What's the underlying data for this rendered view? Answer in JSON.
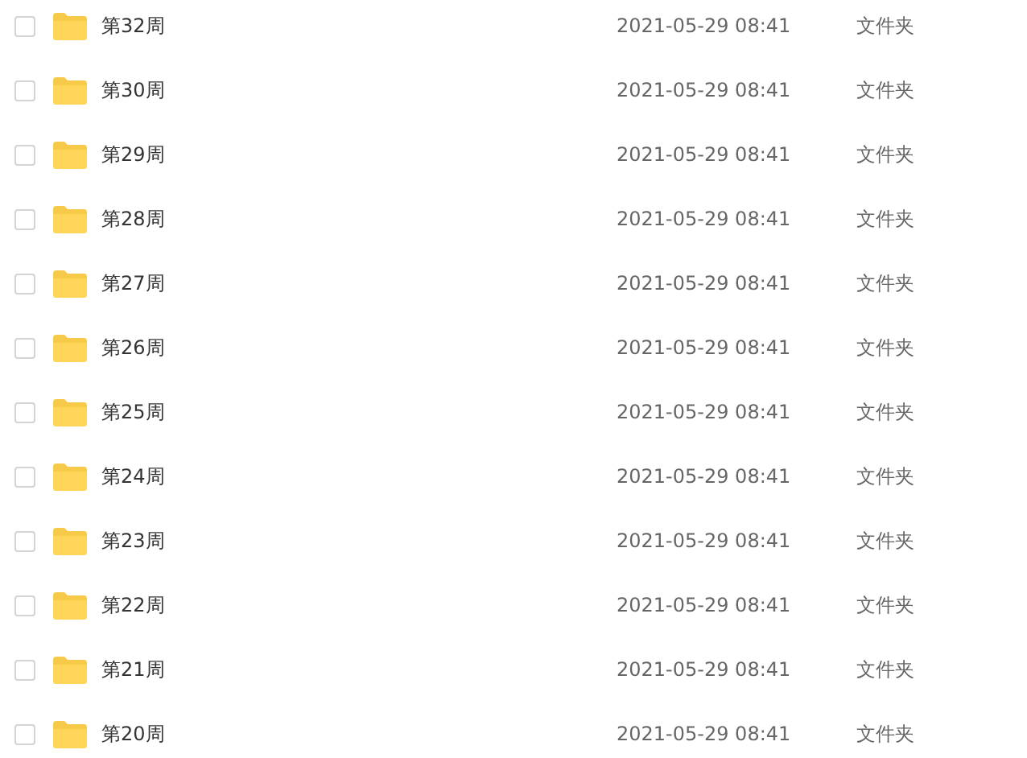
{
  "files": [
    {
      "name": "第32周",
      "modified": "2021-05-29 08:41",
      "type": "文件夹",
      "checked": false
    },
    {
      "name": "第30周",
      "modified": "2021-05-29 08:41",
      "type": "文件夹",
      "checked": false
    },
    {
      "name": "第29周",
      "modified": "2021-05-29 08:41",
      "type": "文件夹",
      "checked": false
    },
    {
      "name": "第28周",
      "modified": "2021-05-29 08:41",
      "type": "文件夹",
      "checked": false
    },
    {
      "name": "第27周",
      "modified": "2021-05-29 08:41",
      "type": "文件夹",
      "checked": false
    },
    {
      "name": "第26周",
      "modified": "2021-05-29 08:41",
      "type": "文件夹",
      "checked": false
    },
    {
      "name": "第25周",
      "modified": "2021-05-29 08:41",
      "type": "文件夹",
      "checked": false
    },
    {
      "name": "第24周",
      "modified": "2021-05-29 08:41",
      "type": "文件夹",
      "checked": false
    },
    {
      "name": "第23周",
      "modified": "2021-05-29 08:41",
      "type": "文件夹",
      "checked": false
    },
    {
      "name": "第22周",
      "modified": "2021-05-29 08:41",
      "type": "文件夹",
      "checked": false
    },
    {
      "name": "第21周",
      "modified": "2021-05-29 08:41",
      "type": "文件夹",
      "checked": false
    },
    {
      "name": "第20周",
      "modified": "2021-05-29 08:41",
      "type": "文件夹",
      "checked": false
    }
  ]
}
